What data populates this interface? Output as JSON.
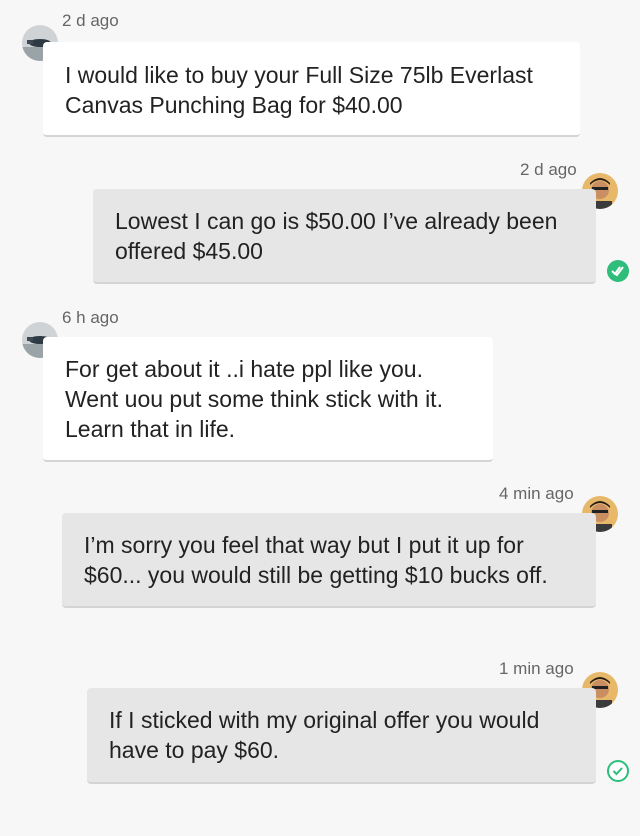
{
  "messages": [
    {
      "sender": "other",
      "time": "2 d ago",
      "text": "I would like to buy your Full Size 75lb Everlast Canvas Punching Bag for $40.00"
    },
    {
      "sender": "me",
      "time": "2 d ago",
      "text": "Lowest I can go is $50.00 I’ve already been offered $45.00",
      "status": "read"
    },
    {
      "sender": "other",
      "time": "6 h ago",
      "text": "For get about it ..i hate ppl like you. Went uou put some think stick with it. Learn that in life."
    },
    {
      "sender": "me",
      "time": "4 min ago",
      "text": "I’m sorry you feel that way but I put it up for $60... you would still be getting $10 bucks off."
    },
    {
      "sender": "me",
      "time": "1 min ago",
      "text": "If I sticked with my original offer you would have to pay $60.",
      "status": "delivered"
    }
  ],
  "colors": {
    "their_bubble": "#ffffff",
    "my_bubble": "#e6e6e6",
    "read_status": "#2ebd7a",
    "delivered_status": "#2ebd7a",
    "background": "#f7f7f7"
  },
  "icons": {
    "other_avatar": "avatar-icon",
    "my_avatar": "avatar-icon",
    "read": "double-check-icon",
    "delivered": "check-circle-icon"
  }
}
